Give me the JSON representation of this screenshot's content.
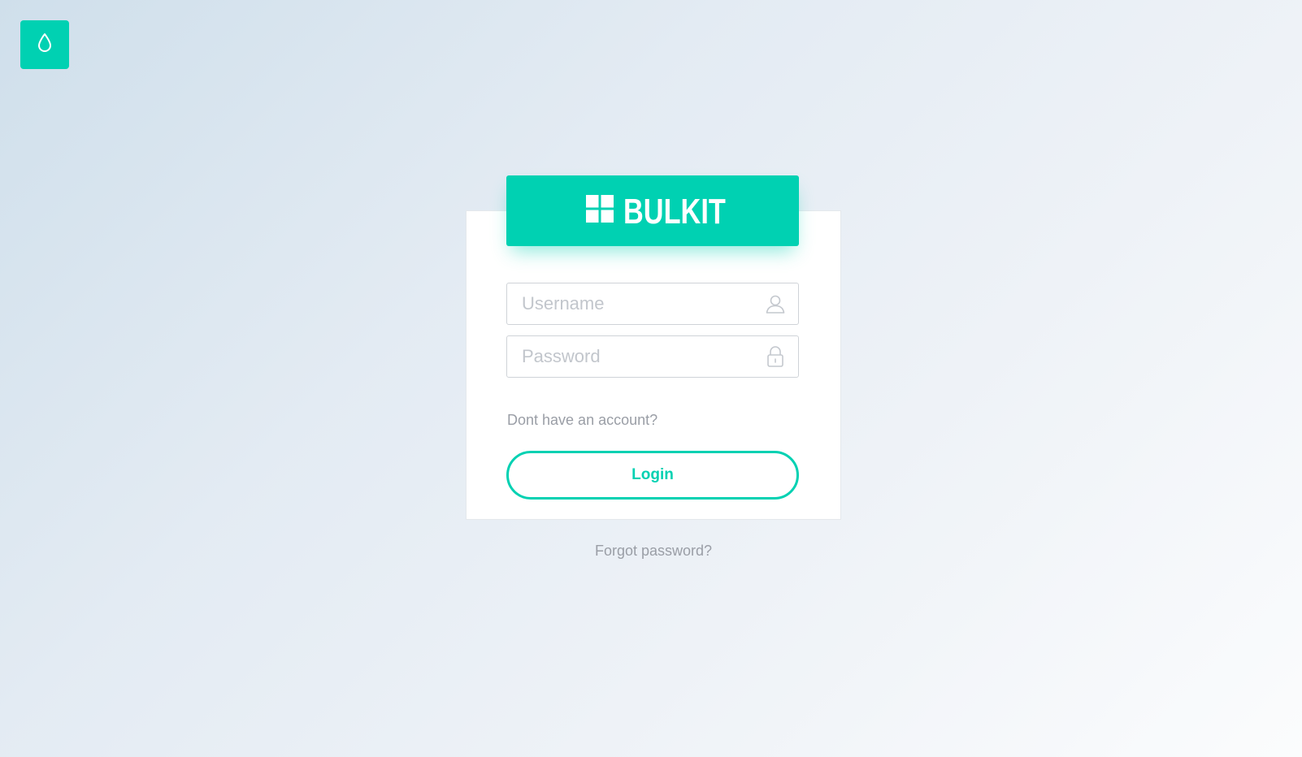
{
  "theme_toggle": {
    "icon": "water-drop-icon",
    "color": "#00d1b2"
  },
  "brand": {
    "name": "BULKIT",
    "logo_icon": "grid-logo-icon",
    "color": "#00d1b2"
  },
  "form": {
    "username": {
      "value": "",
      "placeholder": "Username",
      "icon": "user-icon"
    },
    "password": {
      "value": "",
      "placeholder": "Password",
      "icon": "lock-icon"
    },
    "signup_link": "Dont have an account?",
    "login_label": "Login"
  },
  "forgot_password": "Forgot password?"
}
